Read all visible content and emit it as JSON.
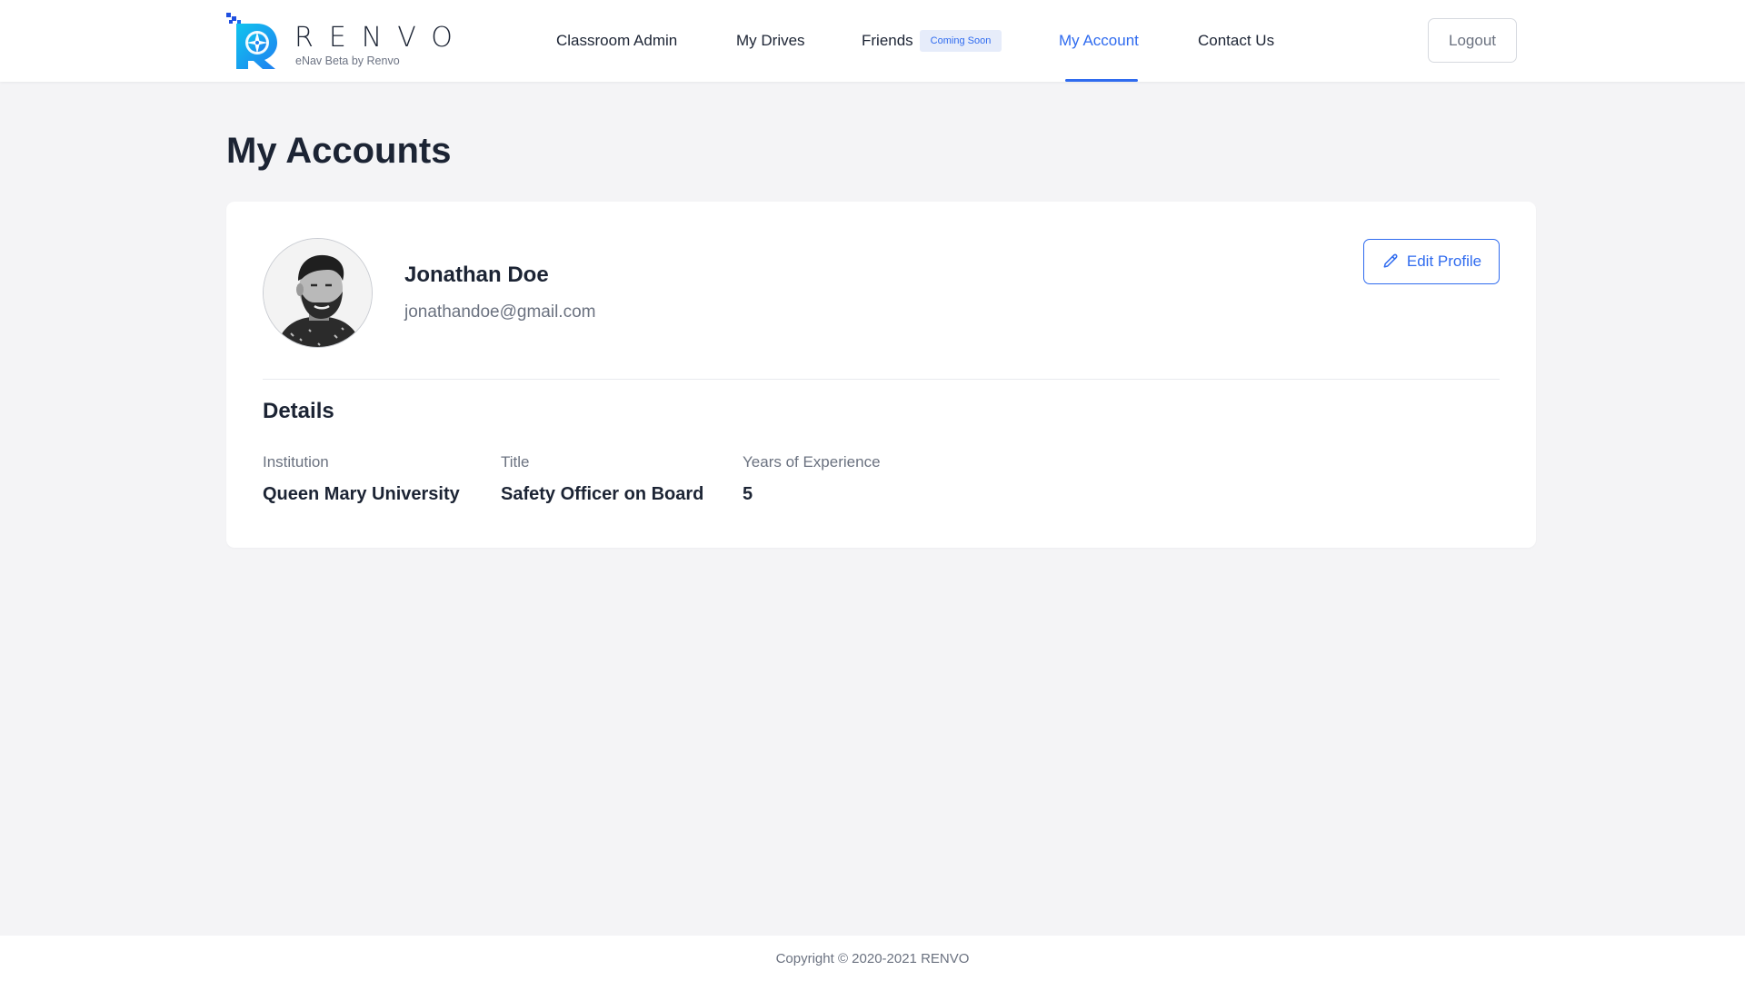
{
  "brand": {
    "name": "RENVO",
    "subtitle": "eNav Beta by Renvo",
    "accent_color": "#2f6bef",
    "logo_gradient": [
      "#11c4ee",
      "#1f7ff0"
    ]
  },
  "nav": {
    "items": [
      {
        "label": "Classroom Admin",
        "active": false
      },
      {
        "label": "My Drives",
        "active": false
      },
      {
        "label": "Friends",
        "active": false,
        "badge": "Coming Soon"
      },
      {
        "label": "My Account",
        "active": true
      },
      {
        "label": "Contact Us",
        "active": false
      }
    ],
    "logout_label": "Logout"
  },
  "page": {
    "title": "My Accounts"
  },
  "profile": {
    "name": "Jonathan Doe",
    "email": "jonathandoe@gmail.com",
    "avatar_icon": "person-portrait-icon",
    "edit_label": "Edit Profile",
    "edit_icon": "pencil-icon"
  },
  "details": {
    "heading": "Details",
    "fields": [
      {
        "label": "Institution",
        "value": "Queen Mary University"
      },
      {
        "label": "Title",
        "value": "Safety Officer on Board"
      },
      {
        "label": "Years of Experience",
        "value": "5"
      }
    ]
  },
  "footer": {
    "copyright": "Copyright © 2020-2021 RENVO"
  }
}
